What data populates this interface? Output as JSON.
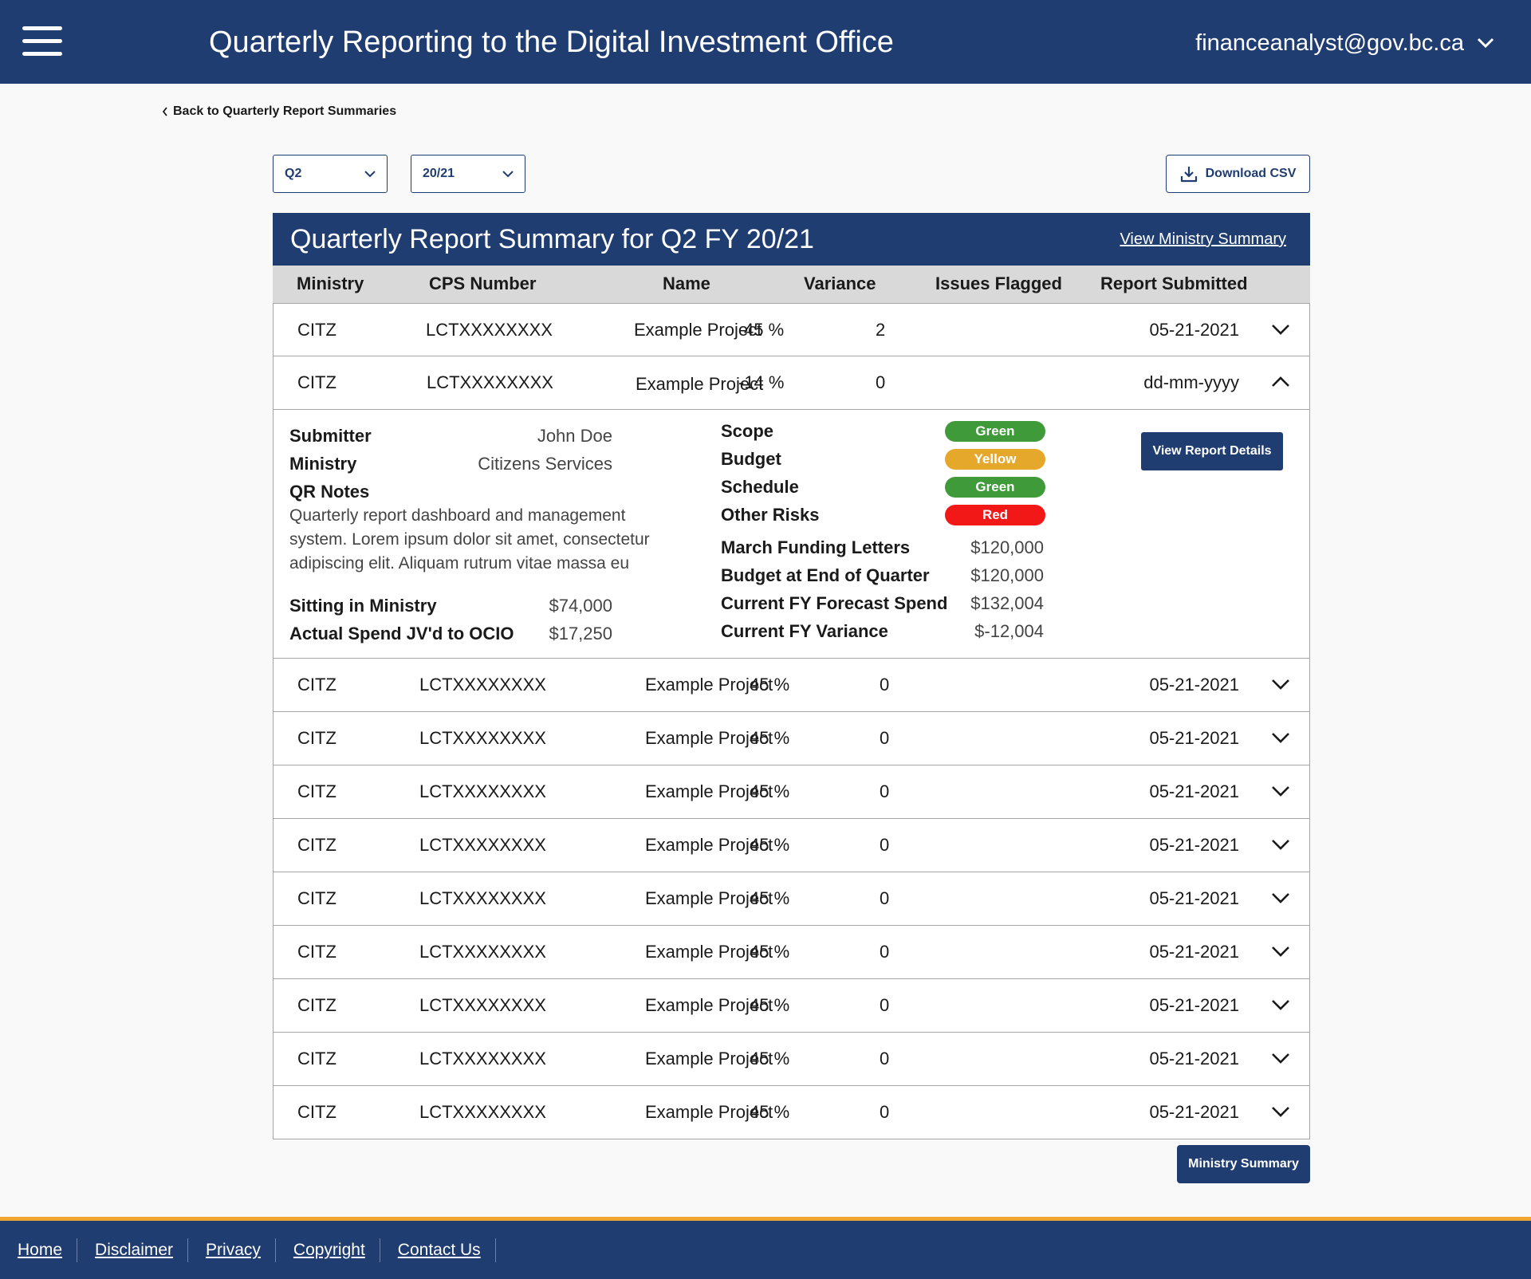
{
  "header": {
    "title": "Quarterly Reporting to the Digital Investment Office",
    "user_email": "financeanalyst@gov.bc.ca"
  },
  "back_link": "Back to Quarterly Report Summaries",
  "filters": {
    "quarter": "Q2",
    "fiscal_year": "20/21",
    "download_label": "Download CSV"
  },
  "summary": {
    "title": "Quarterly Report Summary for Q2 FY 20/21",
    "view_ministry_link": "View Ministry Summary",
    "columns": [
      "Ministry",
      "CPS Number",
      "Name",
      "Variance",
      "Issues Flagged",
      "Report Submitted"
    ],
    "rows": [
      {
        "ministry": "CITZ",
        "cps": "LCTXXXXXXXX",
        "name": "Example Project",
        "variance": "45 %",
        "issues": "2",
        "submitted": "05-21-2021",
        "expanded": false
      },
      {
        "ministry": "CITZ",
        "cps": "LCTXXXXXXXX",
        "name": "Example Project",
        "variance": "-14 %",
        "issues": "0",
        "submitted": "dd-mm-yyyy",
        "expanded": true
      },
      {
        "ministry": "CITZ",
        "cps": "LCTXXXXXXXX",
        "name": "Example Project",
        "variance": "45 %",
        "issues": "0",
        "submitted": "05-21-2021",
        "expanded": false
      },
      {
        "ministry": "CITZ",
        "cps": "LCTXXXXXXXX",
        "name": "Example Project",
        "variance": "45 %",
        "issues": "0",
        "submitted": "05-21-2021",
        "expanded": false
      },
      {
        "ministry": "CITZ",
        "cps": "LCTXXXXXXXX",
        "name": "Example Project",
        "variance": "45 %",
        "issues": "0",
        "submitted": "05-21-2021",
        "expanded": false
      },
      {
        "ministry": "CITZ",
        "cps": "LCTXXXXXXXX",
        "name": "Example Project",
        "variance": "45 %",
        "issues": "0",
        "submitted": "05-21-2021",
        "expanded": false
      },
      {
        "ministry": "CITZ",
        "cps": "LCTXXXXXXXX",
        "name": "Example Project",
        "variance": "45 %",
        "issues": "0",
        "submitted": "05-21-2021",
        "expanded": false
      },
      {
        "ministry": "CITZ",
        "cps": "LCTXXXXXXXX",
        "name": "Example Project",
        "variance": "45 %",
        "issues": "0",
        "submitted": "05-21-2021",
        "expanded": false
      },
      {
        "ministry": "CITZ",
        "cps": "LCTXXXXXXXX",
        "name": "Example Project",
        "variance": "45 %",
        "issues": "0",
        "submitted": "05-21-2021",
        "expanded": false
      },
      {
        "ministry": "CITZ",
        "cps": "LCTXXXXXXXX",
        "name": "Example Project",
        "variance": "45 %",
        "issues": "0",
        "submitted": "05-21-2021",
        "expanded": false
      },
      {
        "ministry": "CITZ",
        "cps": "LCTXXXXXXXX",
        "name": "Example Project",
        "variance": "45 %",
        "issues": "0",
        "submitted": "05-21-2021",
        "expanded": false
      }
    ]
  },
  "detail": {
    "submitter_label": "Submitter",
    "submitter": "John Doe",
    "ministry_label": "Ministry",
    "ministry": "Citizens Services",
    "notes_label": "QR Notes",
    "notes": "Quarterly report dashboard and management system. Lorem ipsum dolor sit amet, consectetur adipiscing elit. Aliquam rutrum vitae massa eu",
    "sitting_label": "Sitting in Ministry",
    "sitting": "$74,000",
    "actual_label": "Actual Spend JV'd to OCIO",
    "actual": "$17,250",
    "statuses": [
      {
        "label": "Scope",
        "status": "Green",
        "color": "#3f9b3a"
      },
      {
        "label": "Budget",
        "status": "Yellow",
        "color": "#e5a82b"
      },
      {
        "label": "Schedule",
        "status": "Green",
        "color": "#3f9b3a"
      },
      {
        "label": "Other Risks",
        "status": "Red",
        "color": "#f21818"
      }
    ],
    "financials": [
      {
        "label": "March Funding Letters",
        "value": "$120,000"
      },
      {
        "label": "Budget at End of Quarter",
        "value": "$120,000"
      },
      {
        "label": "Current FY Forecast Spend",
        "value": "$132,004"
      },
      {
        "label": "Current FY Variance",
        "value": "$-12,004"
      }
    ],
    "view_details_label": "View Report Details"
  },
  "ministry_summary_button": "Ministry Summary",
  "footer": {
    "links": [
      "Home",
      "Disclaimer",
      "Privacy",
      "Copyright",
      "Contact Us"
    ]
  }
}
